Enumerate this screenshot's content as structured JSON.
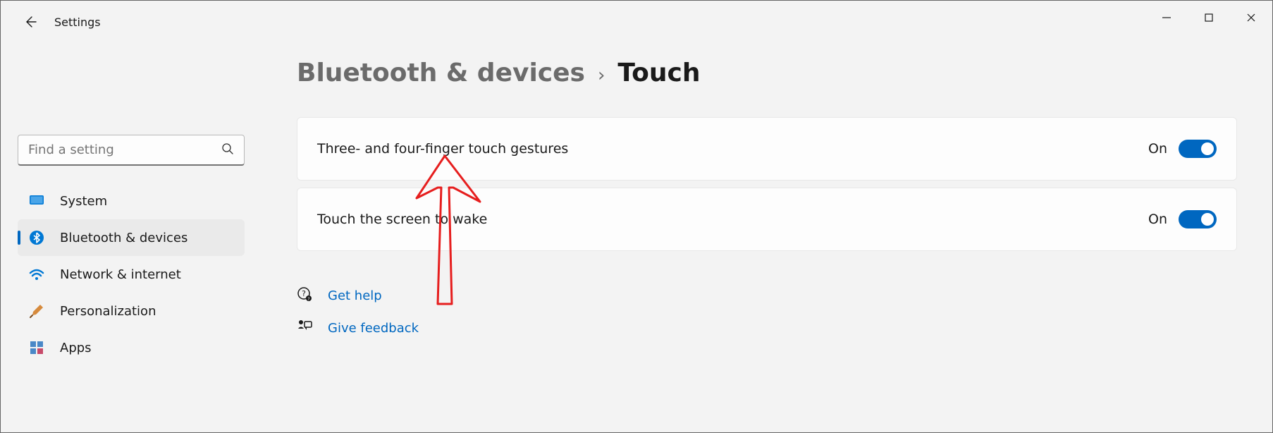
{
  "app_title": "Settings",
  "search": {
    "placeholder": "Find a setting"
  },
  "sidebar": {
    "items": [
      {
        "label": "System"
      },
      {
        "label": "Bluetooth & devices"
      },
      {
        "label": "Network & internet"
      },
      {
        "label": "Personalization"
      },
      {
        "label": "Apps"
      }
    ],
    "active_index": 1
  },
  "breadcrumb": {
    "parent": "Bluetooth & devices",
    "separator": "›",
    "current": "Touch"
  },
  "settings": [
    {
      "label": "Three- and four-finger touch gestures",
      "state": "On"
    },
    {
      "label": "Touch the screen to wake",
      "state": "On"
    }
  ],
  "links": {
    "help": "Get help",
    "feedback": "Give feedback"
  },
  "colors": {
    "accent": "#0067c0"
  }
}
